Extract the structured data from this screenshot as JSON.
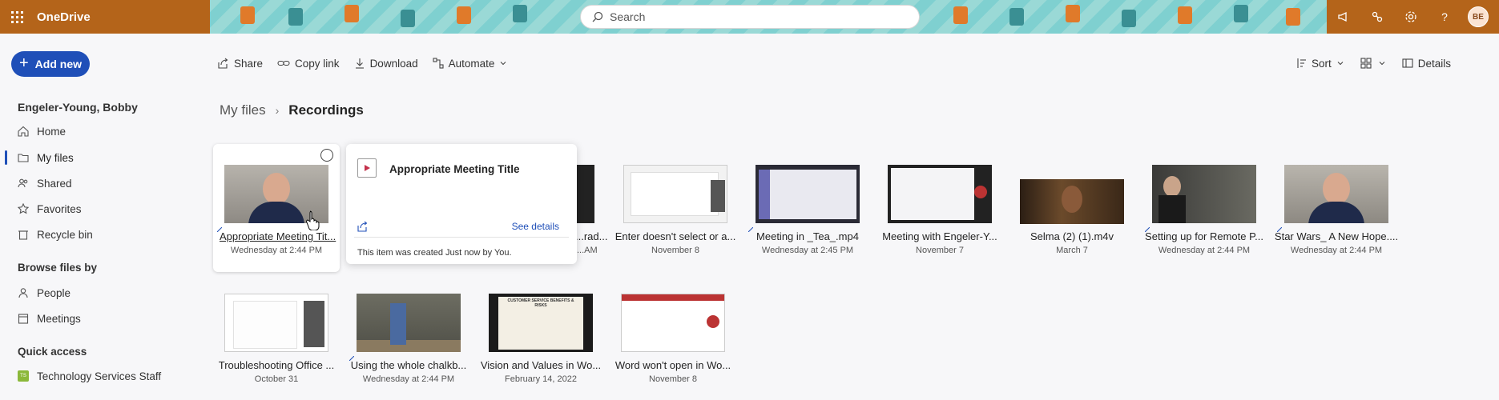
{
  "app": {
    "name": "OneDrive"
  },
  "search": {
    "placeholder": "Search"
  },
  "header": {
    "avatar_initials": "BE",
    "icons": [
      "megaphone-icon",
      "connect-icon",
      "gear-icon",
      "help-icon"
    ]
  },
  "sidebar": {
    "add_new": "Add new",
    "user": "Engeler-Young, Bobby",
    "nav": [
      {
        "label": "Home",
        "icon": "home-icon"
      },
      {
        "label": "My files",
        "icon": "folder-icon",
        "active": true
      },
      {
        "label": "Shared",
        "icon": "people-icon"
      },
      {
        "label": "Favorites",
        "icon": "star-icon"
      },
      {
        "label": "Recycle bin",
        "icon": "trash-icon"
      }
    ],
    "browse_title": "Browse files by",
    "browse": [
      {
        "label": "People",
        "icon": "person-icon"
      },
      {
        "label": "Meetings",
        "icon": "calendar-icon"
      }
    ],
    "quick_access_title": "Quick access",
    "quick_access": [
      {
        "label": "Technology Services Staff",
        "badge": "TS"
      }
    ]
  },
  "commands": {
    "share": "Share",
    "copy_link": "Copy link",
    "download": "Download",
    "automate": "Automate",
    "sort": "Sort",
    "details": "Details"
  },
  "breadcrumb": {
    "root": "My files",
    "current": "Recordings"
  },
  "files": [
    {
      "name": "Appropriate Meeting Tit...",
      "date": "Wednesday at 2:44 PM"
    },
    {
      "name": "...rad...",
      "date": "...AM"
    },
    {
      "name": "Enter doesn't select or a...",
      "date": "November 8"
    },
    {
      "name": "Meeting in _Tea_.mp4",
      "date": "Wednesday at 2:45 PM"
    },
    {
      "name": "Meeting with Engeler-Y...",
      "date": "November 7"
    },
    {
      "name": "Selma (2) (1).m4v",
      "date": "March 7"
    },
    {
      "name": "Setting up for Remote P...",
      "date": "Wednesday at 2:44 PM"
    },
    {
      "name": "Star Wars_ A New Hope....",
      "date": "Wednesday at 2:44 PM"
    },
    {
      "name": "Troubleshooting Office ...",
      "date": "October 31"
    },
    {
      "name": "Using the whole chalkb...",
      "date": "Wednesday at 2:44 PM"
    },
    {
      "name": "Vision and Values in Wo...",
      "date": "February 14, 2022"
    },
    {
      "name": "Word won't open in Wo...",
      "date": "November 8"
    }
  ],
  "thumb_text": {
    "vision": "CUSTOMER SERVICE BENEFITS & RISKS"
  },
  "popup": {
    "title": "Appropriate Meeting Title",
    "see_details": "See details",
    "note": "This item was created Just now by You."
  }
}
